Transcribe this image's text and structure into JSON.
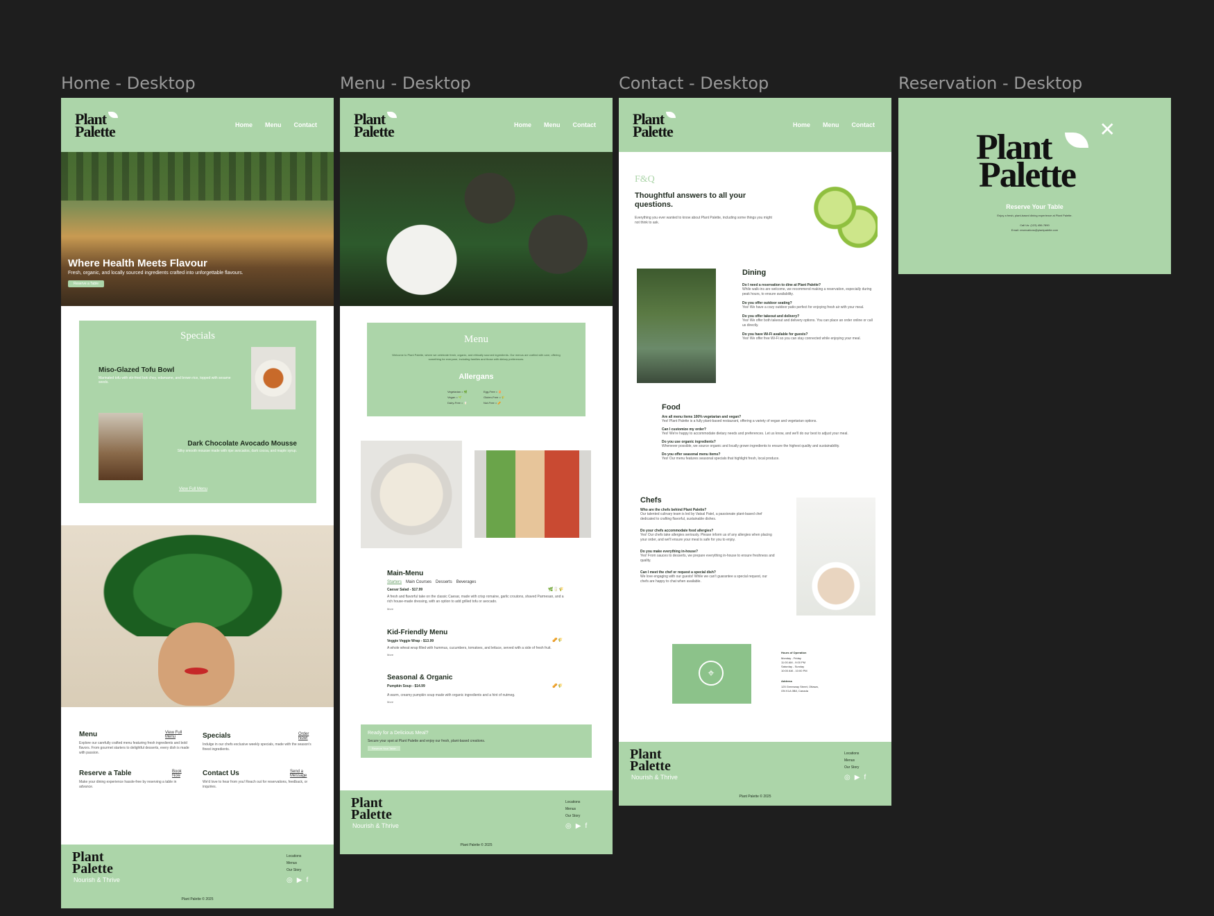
{
  "frames": {
    "home": "Home - Desktop",
    "menu": "Menu - Desktop",
    "contact": "Contact - Desktop",
    "reservation": "Reservation - Desktop"
  },
  "brand": {
    "logo_line1": "Plant",
    "logo_line2": "Palette",
    "tagline": "Nourish & Thrive",
    "copyright": "Plant Palette © 2025"
  },
  "nav": {
    "home": "Home",
    "menu": "Menu",
    "contact": "Contact"
  },
  "footer_links": {
    "locations": "Locations",
    "menus": "Menus",
    "story": "Our Story"
  },
  "home": {
    "hero_title": "Where Health Meets Flavour",
    "hero_sub": "Fresh, organic, and locally sourced ingredients crafted into unforgettable flavours.",
    "hero_btn": "Reserve a Table",
    "specials_title": "Specials",
    "dish1_title": "Miso-Glazed Tofu Bowl",
    "dish1_desc": "Marinated tofu with stir-fried bok choy, edamame, and brown rice, topped with sesame seeds.",
    "dish2_title": "Dark Chocolate Avocado Mousse",
    "dish2_desc": "Silky smooth mousse made with ripe avocados, dark cocoa, and maple syrup.",
    "view_menu": "View Full Menu",
    "cards": [
      {
        "title": "Menu",
        "link": "View Full Menu",
        "desc": "Explore our carefully crafted menu featuring fresh ingredients and bold flavors. From gourmet starters to delightful desserts, every dish is made with passion."
      },
      {
        "title": "Specials",
        "link": "Order Now!",
        "desc": "Indulge in our chefs exclusive weekly specials, made with the season's finest ingredients."
      },
      {
        "title": "Reserve a Table",
        "link": "Book Now",
        "desc": "Make your dining experience hassle-free by reserving a table in advance."
      },
      {
        "title": "Contact Us",
        "link": "Send a Message",
        "desc": "We'd love to hear from you! Reach out for reservations, feedback, or inquiries."
      }
    ]
  },
  "menu": {
    "title": "Menu",
    "intro": "Welcome to Plant Palette, where we celebrate fresh, organic, and ethically sourced ingredients. Our menus are crafted with care, offering something for everyone, including families and those with dietary preferences.",
    "allergens_title": "Allergans",
    "allergens_left": [
      "Vegetarian = 🌿",
      "Vegan = 🌱",
      "Dairy-Free = 🥛"
    ],
    "allergens_right": [
      "Egg-Free = 🥚",
      "Gluten-Free = 🌾",
      "Nut-Free = 🥜"
    ],
    "main_title": "Main-Menu",
    "tabs": [
      "Starters",
      "Main Courses",
      "Desserts",
      "Beverages"
    ],
    "item1": "Caesar Salad - $17.99",
    "item1_desc": "A fresh and flavorful take on the classic Caesar, made with crisp romaine, garlic croutons, shaved Parmesan, and a rich house-made dressing, with an option to add grilled tofu or avocado.",
    "more": "More",
    "kids_title": "Kid-Friendly Menu",
    "item2": "Veggie Veggie Wrap - $13.99",
    "item2_desc": "A whole wheat wrap filled with hummus, cucumbers, tomatoes, and lettuce, served with a side of fresh fruit.",
    "seasonal_title": "Seasonal & Organic",
    "item3": "Pumpkin Soup - $14.99",
    "item3_desc": "A warm, creamy pumpkin soup made with organic ingredients and a hint of nutmeg.",
    "cta_title": "Ready for a Delicious Meal?",
    "cta_text": "Secure your spot at Plant Palette and enjoy our fresh, plant-based creations.",
    "cta_btn": "Reserve Your Table"
  },
  "contact": {
    "faq": "F&Q",
    "title": "Thoughtful answers to all your questions.",
    "intro": "Everything you ever wanted to know about Plant Palette, including some things you might not think to ask.",
    "dining_title": "Dining",
    "dining": [
      {
        "q": "Do I need a reservation to dine at Plant Palette?",
        "a": "While walk-ins are welcome, we recommend making a reservation, especially during peak hours, to ensure availability."
      },
      {
        "q": "Do you offer outdoor seating?",
        "a": "Yes! We have a cozy outdoor patio perfect for enjoying fresh air with your meal."
      },
      {
        "q": "Do you offer takeout and delivery?",
        "a": "Yes! We offer both takeout and delivery options. You can place an order online or call us directly."
      },
      {
        "q": "Do you have Wi-Fi available for guests?",
        "a": "Yes! We offer free Wi-Fi so you can stay connected while enjoying your meal."
      }
    ],
    "food_title": "Food",
    "food": [
      {
        "q": "Are all menu items 100% vegetarian and vegan?",
        "a": "Yes! Plant Palette is a fully plant-based restaurant, offering a variety of vegan and vegetarian options."
      },
      {
        "q": "Can I customize my order?",
        "a": "Yes! We're happy to accommodate dietary needs and preferences. Let us know, and we'll do our best to adjust your meal."
      },
      {
        "q": "Do you use organic ingredients?",
        "a": "Whenever possible, we source organic and locally grown ingredients to ensure the highest quality and sustainability."
      },
      {
        "q": "Do you offer seasonal menu items?",
        "a": "Yes! Our menu features seasonal specials that highlight fresh, local produce."
      }
    ],
    "chefs_title": "Chefs",
    "chefs": [
      {
        "q": "Who are the chefs behind Plant Palette?",
        "a": "Our talented culinary team is led by Vatsal Patel, a passionate plant-based chef dedicated to crafting flavorful, sustainable dishes."
      },
      {
        "q": "Do your chefs accommodate food allergies?",
        "a": "Yes! Our chefs take allergies seriously. Please inform us of any allergies when placing your order, and we'll ensure your meal is safe for you to enjoy."
      },
      {
        "q": "Do you make everything in-house?",
        "a": "Yes! From sauces to desserts, we prepare everything in-house to ensure freshness and quality."
      },
      {
        "q": "Can I meet the chef or request a special dish?",
        "a": "We love engaging with our guests! While we can't guarantee a special request, our chefs are happy to chat when available."
      }
    ],
    "hours_title": "Hours of Operation",
    "hours": [
      "Monday - Friday",
      "11:00 AM - 9:00 PM",
      "Saturday - Sunday",
      "10:00 AM - 10:00 PM"
    ],
    "address_title": "Address",
    "address": [
      "125 Greenway Street, Ottawa,",
      "ON K1A 0B8, Canada"
    ]
  },
  "reservation": {
    "title": "Reserve Your Table",
    "sub": "Enjoy a fresh, plant-based dining experience at Plant Palette.",
    "phone": "Call Us: (123) 456-7890",
    "email": "Email: reservations@plantpalette.com"
  },
  "colors": {
    "accent": "#acd5a9",
    "dark_bg": "#1e1e1e"
  }
}
